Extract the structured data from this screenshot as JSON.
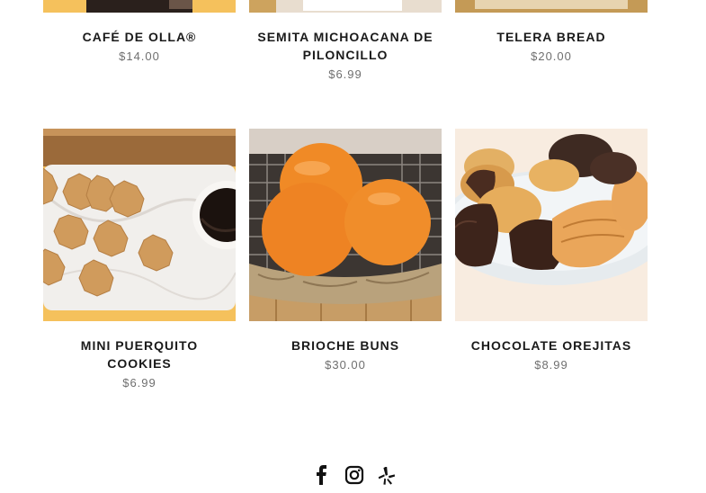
{
  "products_top": [
    {
      "name": "CAFÉ DE OLLA®",
      "price": "$14.00",
      "image": "cafe-de-olla-box"
    },
    {
      "name": "SEMITA MICHOACANA DE PILONCILLO",
      "price": "$6.99",
      "image": "semita-bread"
    },
    {
      "name": "TELERA BREAD",
      "price": "$20.00",
      "image": "telera-bread"
    }
  ],
  "products_bottom": [
    {
      "name": "MINI PUERQUITO COOKIES",
      "price": "$6.99",
      "image": "puerquito-cookies-coffee"
    },
    {
      "name": "BRIOCHE BUNS",
      "price": "$30.00",
      "image": "brioche-buns-basket"
    },
    {
      "name": "CHOCOLATE OREJITAS",
      "price": "$8.99",
      "image": "chocolate-orejitas-plate"
    }
  ],
  "social": [
    {
      "icon": "facebook-icon"
    },
    {
      "icon": "instagram-icon"
    },
    {
      "icon": "yelp-icon"
    }
  ],
  "colors": {
    "title": "#1a1a1a",
    "price": "#6f6f6f",
    "accent": "#f5c15c"
  }
}
